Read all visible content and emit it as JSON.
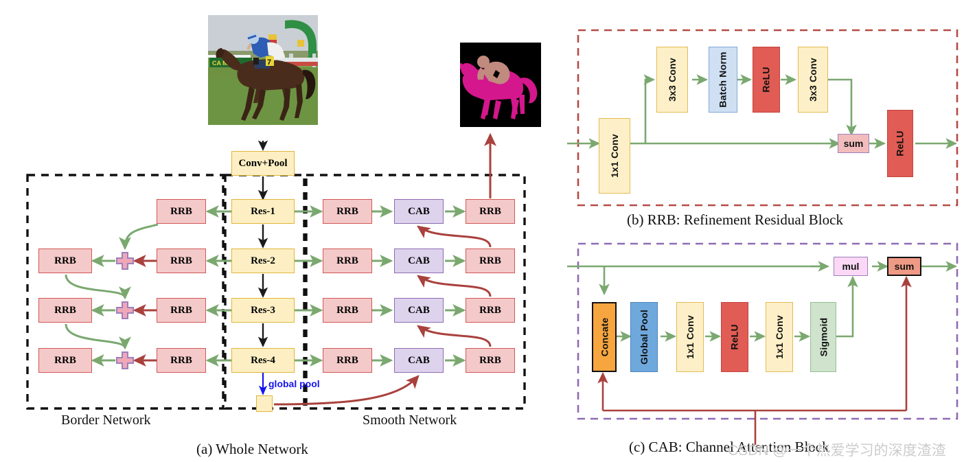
{
  "figure": {
    "captions": {
      "a": "(a) Whole Network",
      "b": "(b) RRB: Refinement Residual Block",
      "c": "(c) CAB: Channel Attention Block"
    },
    "watermark": "CSDN @一个热爱学习的深度渣渣"
  },
  "panel_a": {
    "group_labels": {
      "border": "Border Network",
      "smooth": "Smooth Network"
    },
    "stem": {
      "conv_pool": "Conv+Pool"
    },
    "backbone": [
      {
        "label": "Res-1"
      },
      {
        "label": "Res-2"
      },
      {
        "label": "Res-3"
      },
      {
        "label": "Res-4"
      }
    ],
    "global_pool_label": "global pool",
    "border_inner": [
      {
        "label": "RRB"
      },
      {
        "label": "RRB"
      },
      {
        "label": "RRB"
      },
      {
        "label": "RRB"
      }
    ],
    "border_outer": [
      {
        "label": "RRB"
      },
      {
        "label": "RRB"
      },
      {
        "label": "RRB"
      }
    ],
    "smooth_left": [
      {
        "label": "RRB"
      },
      {
        "label": "RRB"
      },
      {
        "label": "RRB"
      },
      {
        "label": "RRB"
      }
    ],
    "smooth_cab": [
      {
        "label": "CAB"
      },
      {
        "label": "CAB"
      },
      {
        "label": "CAB"
      },
      {
        "label": "CAB"
      }
    ],
    "smooth_right": [
      {
        "label": "RRB"
      },
      {
        "label": "RRB"
      },
      {
        "label": "RRB"
      },
      {
        "label": "RRB"
      }
    ],
    "images": {
      "input_alt": "input-photo-jockey-on-horse",
      "output_alt": "segmentation-mask-horse-person"
    }
  },
  "panel_b": {
    "blocks": [
      {
        "label": "1x1 Conv"
      },
      {
        "label": "3x3 Conv"
      },
      {
        "label": "Batch Norm"
      },
      {
        "label": "ReLU"
      },
      {
        "label": "3x3 Conv"
      },
      {
        "label": "sum"
      },
      {
        "label": "ReLU"
      }
    ]
  },
  "panel_c": {
    "blocks": [
      {
        "label": "Concate"
      },
      {
        "label": "Global Pool"
      },
      {
        "label": "1x1 Conv"
      },
      {
        "label": "ReLU"
      },
      {
        "label": "1x1 Conv"
      },
      {
        "label": "Sigmoid"
      },
      {
        "label": "mul"
      },
      {
        "label": "sum"
      }
    ]
  },
  "colors": {
    "green_arrow": "#7aa86f",
    "red_arrow": "#a9413d",
    "blue_arrow": "#1414f0",
    "black_arrow": "#1a1a1a",
    "res_fill": "#fdefc3",
    "res_stroke": "#e0b63c",
    "rrb_fill": "#f4c9c9",
    "rrb_stroke": "#d15656",
    "cab_fill": "#ddd3ec",
    "cab_stroke": "#8e6bb3",
    "panel_b_border": "#b54b45",
    "panel_c_border": "#8e6bb3",
    "plus_fill": "#eea8b6",
    "plus_stroke": "#9e7fbc"
  }
}
